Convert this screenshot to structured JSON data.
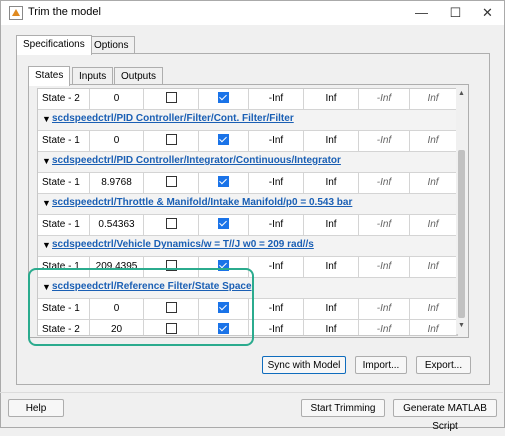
{
  "window": {
    "title": "Trim the model",
    "minimize": "—",
    "maximize": "☐",
    "close": "✕"
  },
  "outer_tabs": [
    {
      "label": "Specifications"
    },
    {
      "label": "Options"
    }
  ],
  "inner_tabs": [
    {
      "label": "States"
    },
    {
      "label": "Inputs"
    },
    {
      "label": "Outputs"
    }
  ],
  "table": {
    "top_row": {
      "name": "State - 2",
      "value": "0",
      "known": false,
      "steady": true,
      "min": "-Inf",
      "max": "Inf",
      "dx_min": "-Inf",
      "dx_max": "Inf"
    },
    "groups": [
      {
        "path": "scdspeedctrl/PID Controller/Filter/Cont. Filter/Filter",
        "rows": [
          {
            "name": "State - 1",
            "value": "0",
            "known": false,
            "steady": true,
            "min": "-Inf",
            "max": "Inf",
            "dx_min": "-Inf",
            "dx_max": "Inf"
          }
        ]
      },
      {
        "path": "scdspeedctrl/PID Controller/Integrator/Continuous/Integrator",
        "rows": [
          {
            "name": "State - 1",
            "value": "8.9768",
            "known": false,
            "steady": true,
            "min": "-Inf",
            "max": "Inf",
            "dx_min": "-Inf",
            "dx_max": "Inf"
          }
        ]
      },
      {
        "path": "scdspeedctrl/Throttle & Manifold/Intake Manifold/p0 = 0.543 bar",
        "rows": [
          {
            "name": "State - 1",
            "value": "0.54363",
            "known": false,
            "steady": true,
            "min": "-Inf",
            "max": "Inf",
            "dx_min": "-Inf",
            "dx_max": "Inf"
          }
        ]
      },
      {
        "path": "scdspeedctrl/Vehicle Dynamics/w = T//J w0 = 209 rad//s",
        "rows": [
          {
            "name": "State - 1",
            "value": "209.4395",
            "known": false,
            "steady": true,
            "min": "-Inf",
            "max": "Inf",
            "dx_min": "-Inf",
            "dx_max": "Inf"
          }
        ]
      },
      {
        "path": "scdspeedctrl/Reference Filter/State Space",
        "rows": [
          {
            "name": "State - 1",
            "value": "0",
            "known": false,
            "steady": true,
            "min": "-Inf",
            "max": "Inf",
            "dx_min": "-Inf",
            "dx_max": "Inf"
          },
          {
            "name": "State - 2",
            "value": "20",
            "known": false,
            "steady": true,
            "min": "-Inf",
            "max": "Inf",
            "dx_min": "-Inf",
            "dx_max": "Inf"
          }
        ]
      }
    ]
  },
  "buttons": {
    "sync": "Sync with Model",
    "import": "Import...",
    "export": "Export...",
    "help": "Help",
    "start": "Start Trimming",
    "generate": "Generate MATLAB Script"
  },
  "colors": {
    "highlight": "#2bab8e",
    "link": "#1a5fb4",
    "checkbox_on": "#1a73e8"
  }
}
